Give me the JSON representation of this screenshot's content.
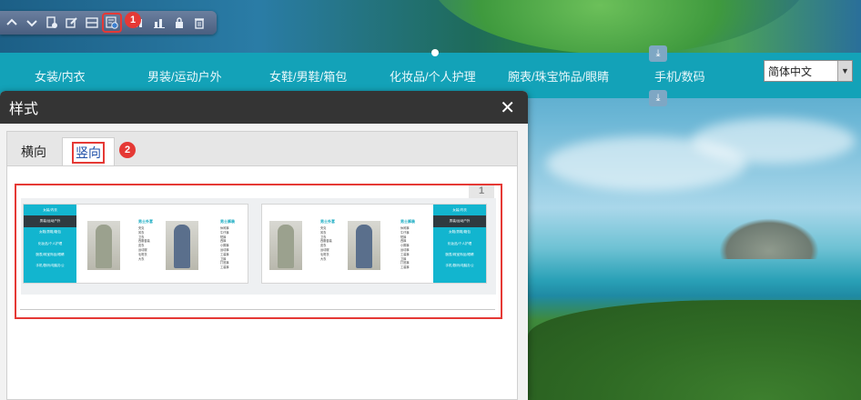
{
  "toolbar": {
    "buttons": [
      {
        "icon": "chevron-up-icon"
      },
      {
        "icon": "chevron-down-icon"
      },
      {
        "icon": "page-settings-icon"
      },
      {
        "icon": "edit-icon"
      },
      {
        "icon": "layout-icon"
      },
      {
        "icon": "style-gear-icon"
      },
      {
        "icon": "columns-icon"
      },
      {
        "icon": "bar-chart-icon"
      },
      {
        "icon": "lock-icon"
      },
      {
        "icon": "trash-icon"
      }
    ],
    "step1_badge": "1"
  },
  "nav": {
    "items": [
      "女装/内衣",
      "男装/运动户外",
      "女鞋/男鞋/箱包",
      "化妆品/个人护理",
      "腕表/珠宝饰品/眼睛",
      "手机/数码"
    ],
    "language_select": "简体中文"
  },
  "dialog": {
    "title": "样式",
    "close_symbol": "✕",
    "tabs": [
      "横向",
      "竖向"
    ],
    "active_tab": "竖向",
    "step2_badge": "2",
    "preview_number": "1",
    "thumbnail": {
      "menu_items": [
        "女装/内衣",
        "男装/运动户外",
        "女鞋/男鞋/箱包",
        "化妆品/个人护理",
        "腕表/珠宝饰品/眼睛",
        "手机/数码/电脑办公"
      ],
      "active_menu_index": 1,
      "col1_heading": "男士外套",
      "col1_items": [
        "夹克",
        "风衣",
        "卫衣",
        "西服套装",
        "皮衣",
        "运动服",
        "毛呢衣",
        "大衣"
      ],
      "col2_heading": "男士裤装",
      "col2_items": [
        "休闲裤",
        "牛仔裤",
        "短裤",
        "西裤",
        "小脚裤",
        "运动裤",
        "工装裤",
        "卫裤",
        "打底裤",
        "工装裤"
      ]
    }
  },
  "colors": {
    "nav_bg": "#13a2b8",
    "menu_cyan": "#12b5cf",
    "highlight_red": "#e53935",
    "dialog_title_bg": "#343434",
    "active_tab_text": "#1e4fa8"
  }
}
